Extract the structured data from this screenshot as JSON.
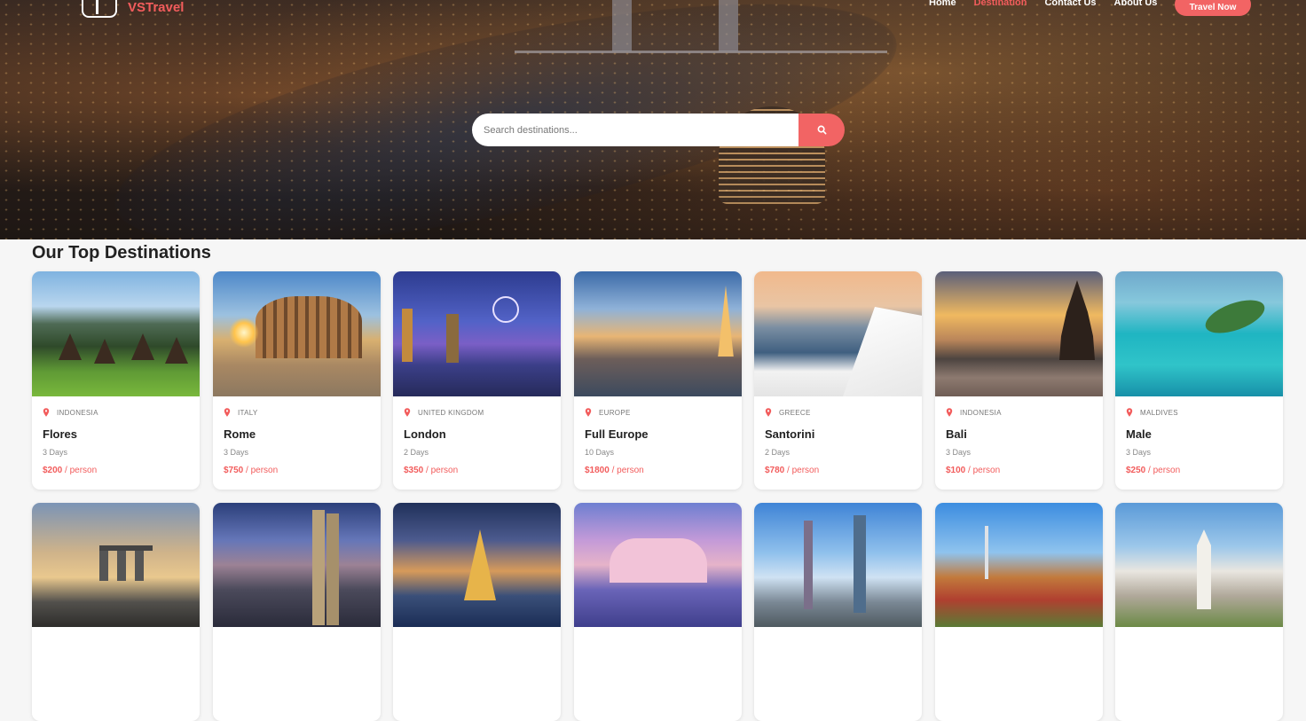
{
  "brand": {
    "name": "VSTravel"
  },
  "nav": {
    "links": [
      {
        "label": "Home",
        "active": false
      },
      {
        "label": "Destination",
        "active": true
      },
      {
        "label": "Contact Us",
        "active": false
      },
      {
        "label": "About Us",
        "active": false
      }
    ],
    "cta_label": "Travel Now"
  },
  "search": {
    "placeholder": "Search destinations...",
    "icon": "search-icon"
  },
  "section": {
    "title": "Our Top Destinations"
  },
  "destinations": [
    {
      "country": "INDONESIA",
      "city": "Flores",
      "days": "3 Days",
      "price": "$200",
      "unit": "/ person"
    },
    {
      "country": "ITALY",
      "city": "Rome",
      "days": "3 Days",
      "price": "$750",
      "unit": "/ person"
    },
    {
      "country": "UNITED KINGDOM",
      "city": "London",
      "days": "2 Days",
      "price": "$350",
      "unit": "/ person"
    },
    {
      "country": "EUROPE",
      "city": "Full Europe",
      "days": "10 Days",
      "price": "$1800",
      "unit": "/ person"
    },
    {
      "country": "GREECE",
      "city": "Santorini",
      "days": "2 Days",
      "price": "$780",
      "unit": "/ person"
    },
    {
      "country": "INDONESIA",
      "city": "Bali",
      "days": "3 Days",
      "price": "$100",
      "unit": "/ person"
    },
    {
      "country": "MALDIVES",
      "city": "Male",
      "days": "3 Days",
      "price": "$250",
      "unit": "/ person"
    }
  ],
  "colors": {
    "accent": "#f26464",
    "title": "#222222",
    "muted": "#888888"
  }
}
